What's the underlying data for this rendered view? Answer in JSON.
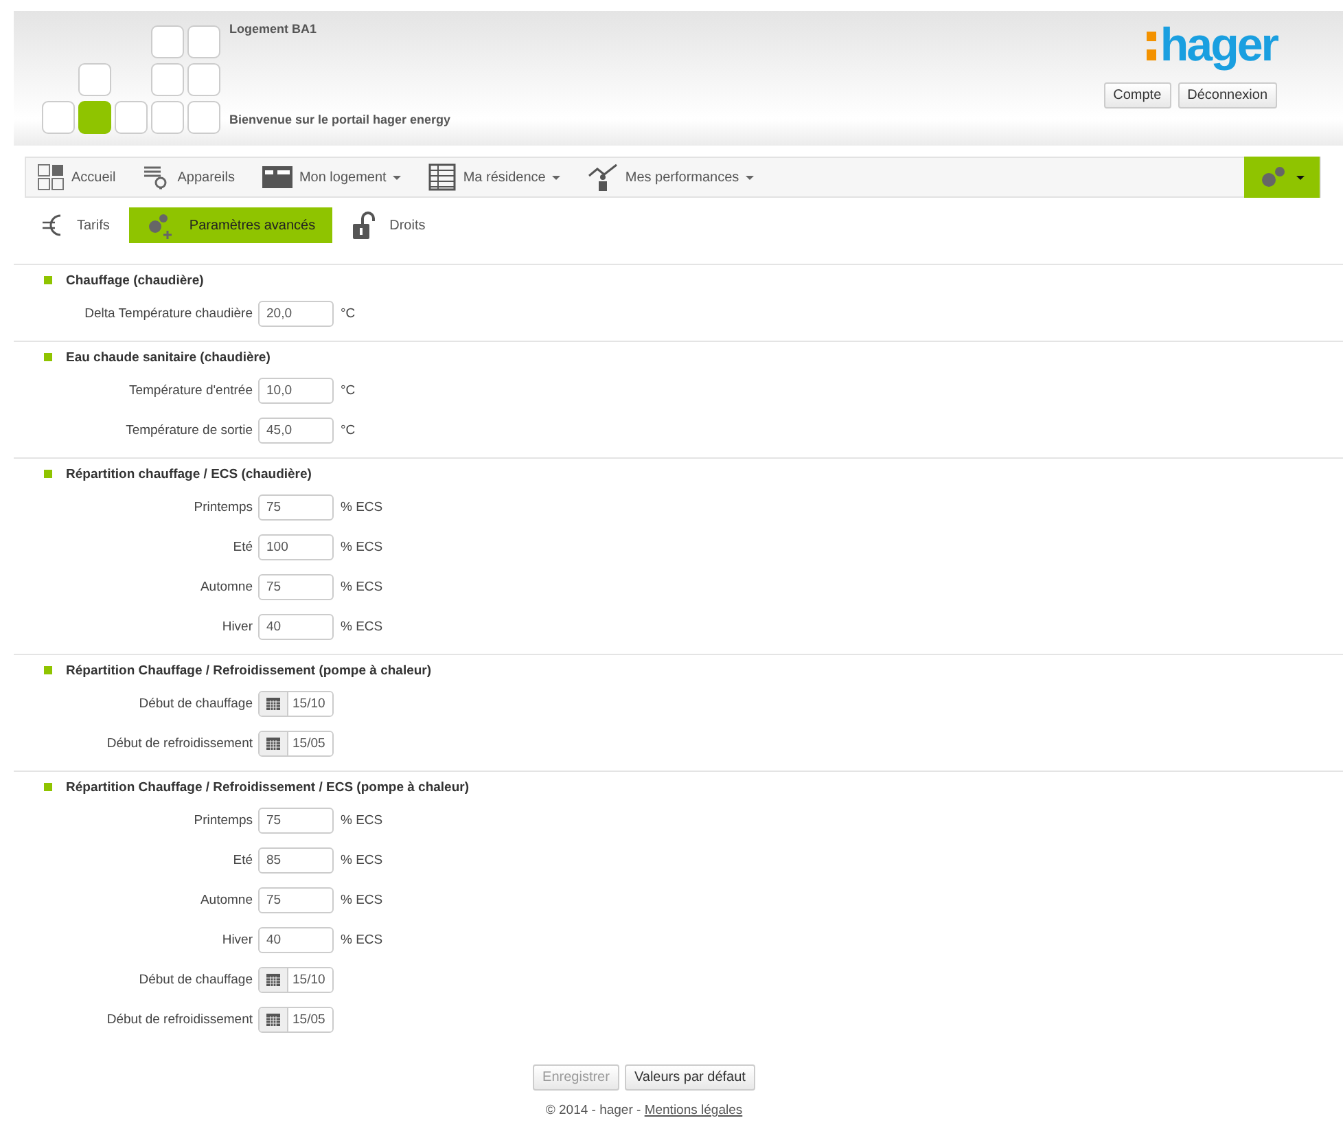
{
  "header": {
    "home_name": "Logement BA1",
    "welcome": "Bienvenue sur le portail hager energy",
    "brand": "hager",
    "buttons": [
      {
        "label": "Compte"
      },
      {
        "label": "Déconnexion"
      }
    ]
  },
  "nav": {
    "items": [
      {
        "label": "Accueil",
        "dropdown": false
      },
      {
        "label": "Appareils",
        "dropdown": false
      },
      {
        "label": "Mon logement",
        "dropdown": true
      },
      {
        "label": "Ma résidence",
        "dropdown": true
      },
      {
        "label": "Mes performances",
        "dropdown": true
      }
    ],
    "settings_selected": true
  },
  "subnav": [
    {
      "label": "Tarifs",
      "selected": false
    },
    {
      "label": "Paramètres avancés",
      "selected": true
    },
    {
      "label": "Droits",
      "selected": false
    }
  ],
  "sections": [
    {
      "title": "Chauffage (chaudière)",
      "fields": [
        {
          "kind": "number",
          "label": "Delta Température chaudière",
          "value": "20,0",
          "unit": "°C"
        }
      ]
    },
    {
      "title": "Eau chaude sanitaire (chaudière)",
      "fields": [
        {
          "kind": "number",
          "label": "Température d'entrée",
          "value": "10,0",
          "unit": "°C"
        },
        {
          "kind": "number",
          "label": "Température de sortie",
          "value": "45,0",
          "unit": "°C"
        }
      ]
    },
    {
      "title": "Répartition chauffage / ECS (chaudière)",
      "fields": [
        {
          "kind": "number",
          "label": "Printemps",
          "value": "75",
          "unit": "% ECS"
        },
        {
          "kind": "number",
          "label": "Eté",
          "value": "100",
          "unit": "% ECS"
        },
        {
          "kind": "number",
          "label": "Automne",
          "value": "75",
          "unit": "% ECS"
        },
        {
          "kind": "number",
          "label": "Hiver",
          "value": "40",
          "unit": "% ECS"
        }
      ]
    },
    {
      "title": "Répartition Chauffage / Refroidissement (pompe à chaleur)",
      "fields": [
        {
          "kind": "date",
          "label": "Début de chauffage",
          "value": "15/10"
        },
        {
          "kind": "date",
          "label": "Début de refroidissement",
          "value": "15/05"
        }
      ]
    },
    {
      "title": "Répartition Chauffage / Refroidissement / ECS (pompe à chaleur)",
      "fields": [
        {
          "kind": "number",
          "label": "Printemps",
          "value": "75",
          "unit": "% ECS"
        },
        {
          "kind": "number",
          "label": "Eté",
          "value": "85",
          "unit": "% ECS"
        },
        {
          "kind": "number",
          "label": "Automne",
          "value": "75",
          "unit": "% ECS"
        },
        {
          "kind": "number",
          "label": "Hiver",
          "value": "40",
          "unit": "% ECS"
        },
        {
          "kind": "date",
          "label": "Début de chauffage",
          "value": "15/10"
        },
        {
          "kind": "date",
          "label": "Début de refroidissement",
          "value": "15/05"
        }
      ]
    }
  ],
  "actions": [
    {
      "label": "Enregistrer",
      "disabled": true
    },
    {
      "label": "Valeurs par défaut",
      "disabled": false
    }
  ],
  "footer": {
    "text": "© 2014 - hager - ",
    "link": "Mentions légales"
  }
}
